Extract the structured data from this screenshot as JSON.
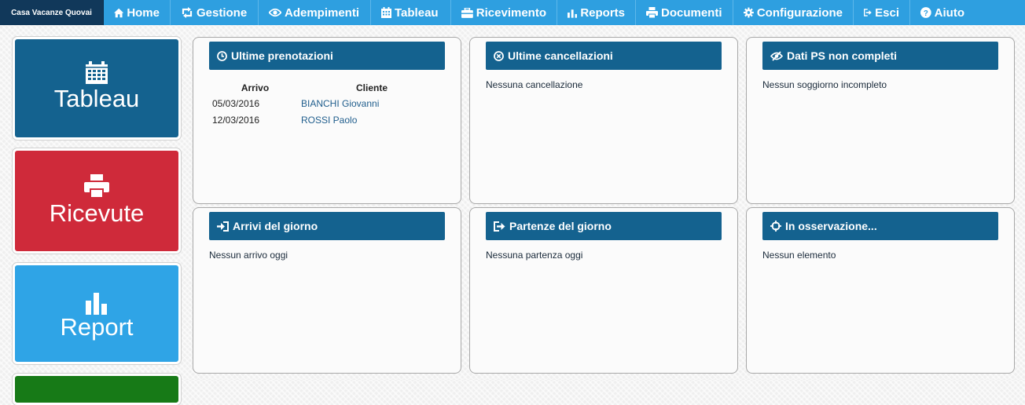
{
  "app": {
    "brand": "Casa Vacanze Quovai"
  },
  "nav": {
    "home": "Home",
    "gestione": "Gestione",
    "adempimenti": "Adempimenti",
    "tableau": "Tableau",
    "ricevimento": "Ricevimento",
    "reports": "Reports",
    "documenti": "Documenti",
    "configurazione": "Configurazione",
    "esci": "Esci",
    "aiuto": "Aiuto"
  },
  "tiles": {
    "tableau": "Tableau",
    "ricevute": "Ricevute",
    "report": "Report"
  },
  "panels": {
    "prenotazioni": {
      "title": "Ultime prenotazioni",
      "col_arrivo": "Arrivo",
      "col_cliente": "Cliente",
      "rows": [
        {
          "arrivo": "05/03/2016",
          "cliente": "BIANCHI Giovanni"
        },
        {
          "arrivo": "12/03/2016",
          "cliente": "ROSSI Paolo"
        }
      ]
    },
    "cancellazioni": {
      "title": "Ultime cancellazioni",
      "empty": "Nessuna cancellazione"
    },
    "datips": {
      "title": "Dati PS non completi",
      "empty": "Nessun soggiorno incompleto"
    },
    "arrivi": {
      "title": "Arrivi del giorno",
      "empty": "Nessun arrivo oggi"
    },
    "partenze": {
      "title": "Partenze del giorno",
      "empty": "Nessuna partenza oggi"
    },
    "osservazione": {
      "title": "In osservazione...",
      "empty": "Nessun elemento"
    }
  },
  "colors": {
    "navbar": "#2e9fe0",
    "brand_bg": "#11385a",
    "panel_header": "#14628f",
    "tile_tableau": "#14628f",
    "tile_ricevute": "#cf2a3a",
    "tile_report": "#2fa4e6",
    "tile_fourth": "#177a17"
  }
}
